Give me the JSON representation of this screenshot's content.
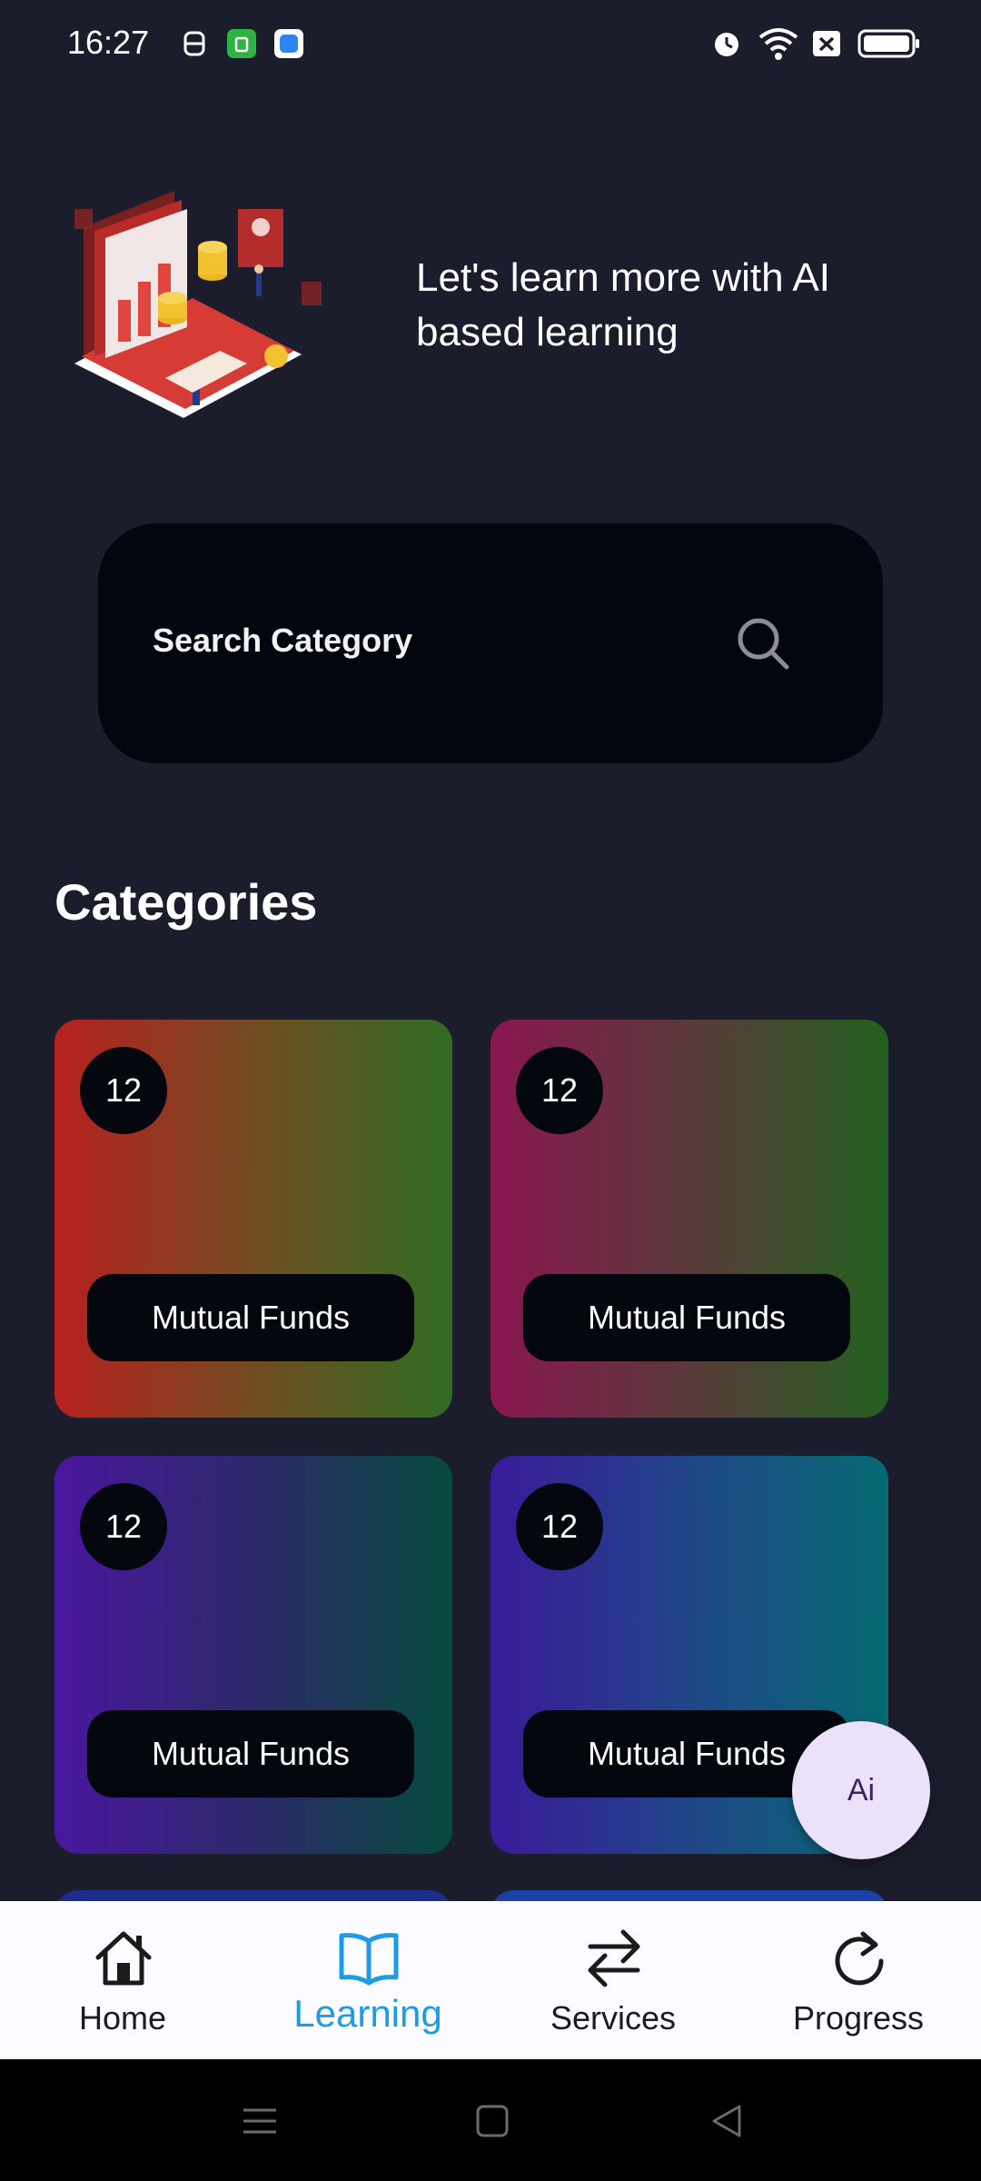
{
  "status_bar": {
    "time": "16:27"
  },
  "hero": {
    "text": "Let's learn more with AI based learning"
  },
  "search": {
    "placeholder": "Search Category"
  },
  "categories": {
    "title": "Categories",
    "items": [
      {
        "count": "12",
        "label": "Mutual Funds"
      },
      {
        "count": "12",
        "label": "Mutual Funds"
      },
      {
        "count": "12",
        "label": "Mutual Funds"
      },
      {
        "count": "12",
        "label": "Mutual Funds"
      }
    ]
  },
  "ai_button": {
    "label": "Ai"
  },
  "bottom_nav": {
    "items": [
      {
        "label": "Home",
        "icon": "home-icon",
        "active": false
      },
      {
        "label": "Learning",
        "icon": "book-icon",
        "active": true
      },
      {
        "label": "Services",
        "icon": "swap-arrows-icon",
        "active": false
      },
      {
        "label": "Progress",
        "icon": "refresh-icon",
        "active": false
      }
    ]
  },
  "colors": {
    "background": "#1c1d2c",
    "accent": "#1d9be3",
    "fab": "#ece1fb"
  }
}
